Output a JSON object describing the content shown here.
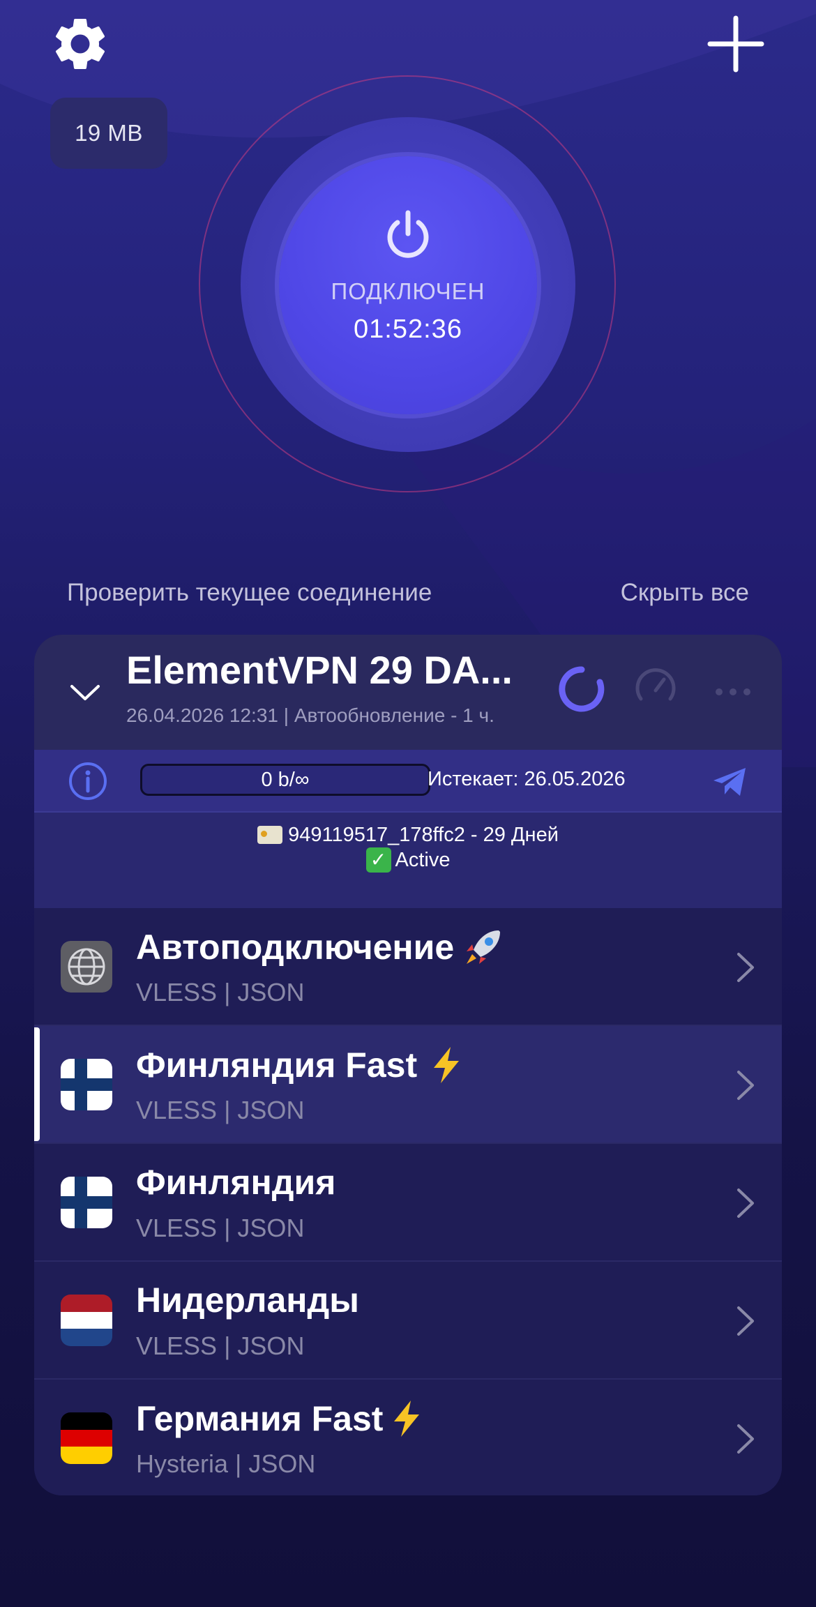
{
  "top_bar": {
    "traffic_used": "19 MB",
    "settings_icon": "gear-icon",
    "add_icon": "plus-icon"
  },
  "connection": {
    "status": "ПОДКЛЮЧЕН",
    "timer": "01:52:36",
    "power_icon": "power-icon"
  },
  "links": {
    "check": "Проверить текущее соединение",
    "hide_all": "Скрыть все"
  },
  "profile": {
    "title": "ElementVPN 29 DA...",
    "subtitle": "26.04.2026 12:31 | Автообновление - 1 ч.",
    "traffic": "0 b/∞",
    "expires": "Истекает: 26.05.2026",
    "note_line1": "949119517_178ffc2 - 29 Дней",
    "note_line2": "Active"
  },
  "servers": [
    {
      "name": "Автоподключение",
      "proto": "VLESS | JSON",
      "icon": "globe-icon",
      "badge": "rocket-emoji",
      "selected": false
    },
    {
      "name": "Финляндия  Fast",
      "proto": "VLESS | JSON",
      "icon": "finland-flag-icon",
      "badge": "lightning-emoji",
      "selected": true
    },
    {
      "name": "Финляндия",
      "proto": "VLESS | JSON",
      "icon": "finland-flag-icon",
      "badge": "",
      "selected": false
    },
    {
      "name": "Нидерланды",
      "proto": "VLESS | JSON",
      "icon": "netherlands-flag-icon",
      "badge": "",
      "selected": false
    },
    {
      "name": "Германия Fast",
      "proto": "Hysteria | JSON",
      "icon": "germany-flag-icon",
      "badge": "lightning-emoji",
      "selected": false
    }
  ],
  "colors": {
    "accent": "#5b54f0",
    "background": "#1c1a60",
    "card": "#201e5a"
  }
}
